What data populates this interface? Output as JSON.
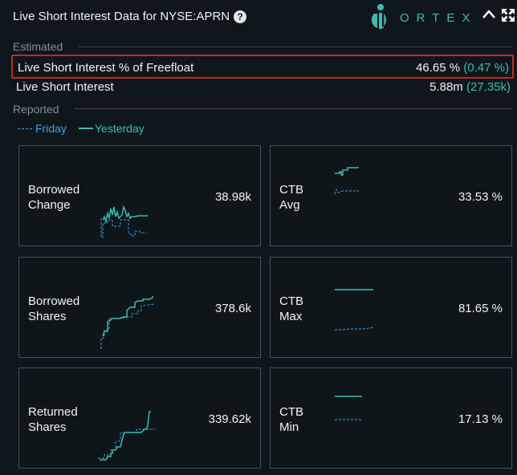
{
  "header": {
    "title": "Live Short Interest Data for NYSE:APRN",
    "help_symbol": "?",
    "brand": "ORTEX"
  },
  "estimated": {
    "section_label": "Estimated",
    "rows": [
      {
        "label": "Live Short Interest % of Freefloat",
        "value": "46.65 %",
        "change": "(0.47 %)",
        "highlighted": true
      },
      {
        "label": "Live Short Interest",
        "value": "5.88m",
        "change": "(27.35k)",
        "highlighted": false
      }
    ]
  },
  "reported": {
    "section_label": "Reported",
    "legend": {
      "friday": "Friday",
      "yesterday": "Yesterday"
    }
  },
  "cards": [
    {
      "label_line1": "Borrowed",
      "label_line2": "Change",
      "value": "38.98k"
    },
    {
      "label_line1": "CTB",
      "label_line2": "Avg",
      "value": "33.53 %"
    },
    {
      "label_line1": "Borrowed",
      "label_line2": "Shares",
      "value": "378.6k"
    },
    {
      "label_line1": "CTB",
      "label_line2": "Max",
      "value": "81.65 %"
    },
    {
      "label_line1": "Returned",
      "label_line2": "Shares",
      "value": "339.62k"
    },
    {
      "label_line1": "CTB",
      "label_line2": "Min",
      "value": "17.13 %"
    }
  ],
  "colors": {
    "yesterday_line": "#3cbcb0",
    "friday_line": "#3ea1e8",
    "highlight_border": "#c62828",
    "background": "#10171c"
  },
  "icons": {
    "help": "help-icon",
    "logo": "ortex-logo-icon",
    "collapse": "chevron-up-icon",
    "expand": "expand-arrows-icon"
  }
}
